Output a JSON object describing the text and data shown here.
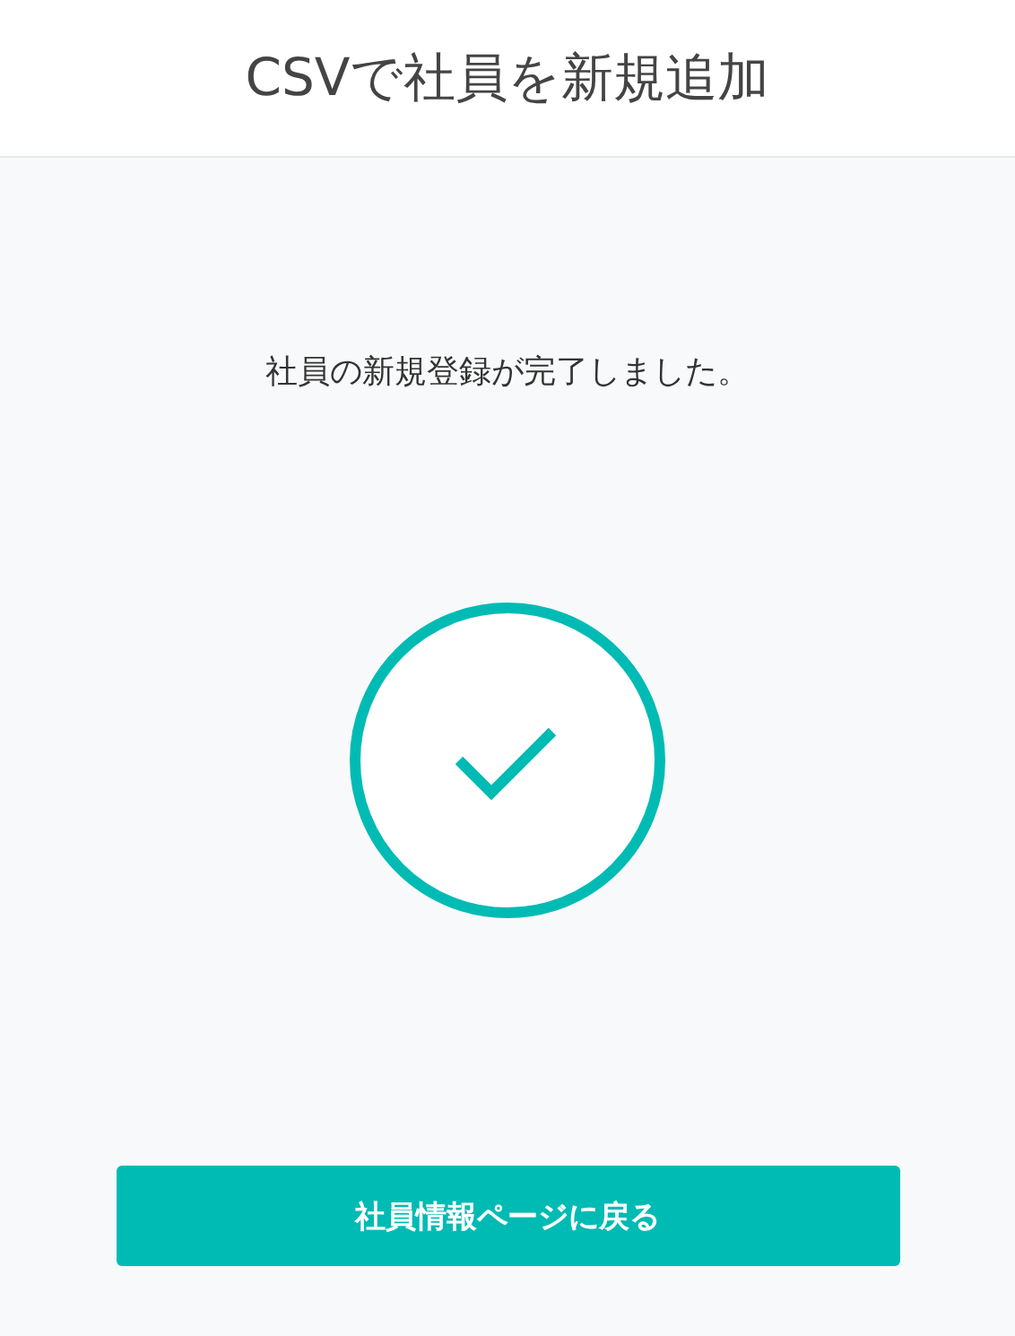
{
  "header": {
    "title": "CSVで社員を新規追加"
  },
  "message": "社員の新規登録が完了しました。",
  "status": {
    "kind": "success"
  },
  "button": {
    "label": "社員情報ページに戻る"
  }
}
